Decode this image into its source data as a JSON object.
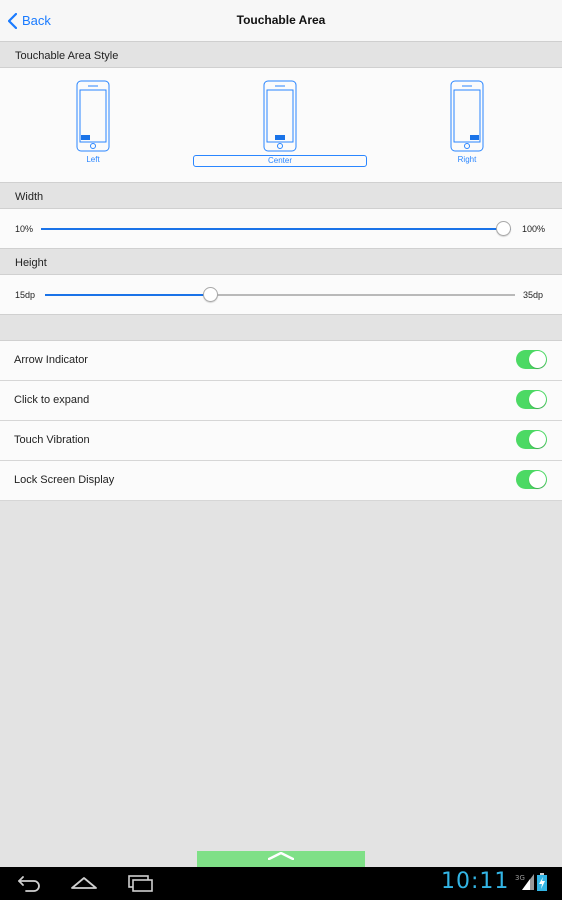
{
  "header": {
    "back_label": "Back",
    "title": "Touchable Area",
    "accent_color": "#1a7bff"
  },
  "touch_style": {
    "section_title": "Touchable Area Style",
    "selected": "Center",
    "options": [
      {
        "label": "Left"
      },
      {
        "label": "Center"
      },
      {
        "label": "Right"
      }
    ]
  },
  "width": {
    "section_title": "Width",
    "min_label": "10%",
    "max_label": "100%",
    "value_fraction": 1.0
  },
  "height": {
    "section_title": "Height",
    "min_label": "15dp",
    "max_label": "35dp",
    "value_fraction": 0.35
  },
  "toggles": [
    {
      "label": "Arrow Indicator",
      "on": true
    },
    {
      "label": "Click to expand",
      "on": true
    },
    {
      "label": "Touch Vibration",
      "on": true
    },
    {
      "label": "Lock Screen Display",
      "on": true
    }
  ],
  "toggle_on_color": "#4cd964",
  "system_bar": {
    "clock": "10:11",
    "network": "3G",
    "clock_color": "#33b5e5"
  }
}
